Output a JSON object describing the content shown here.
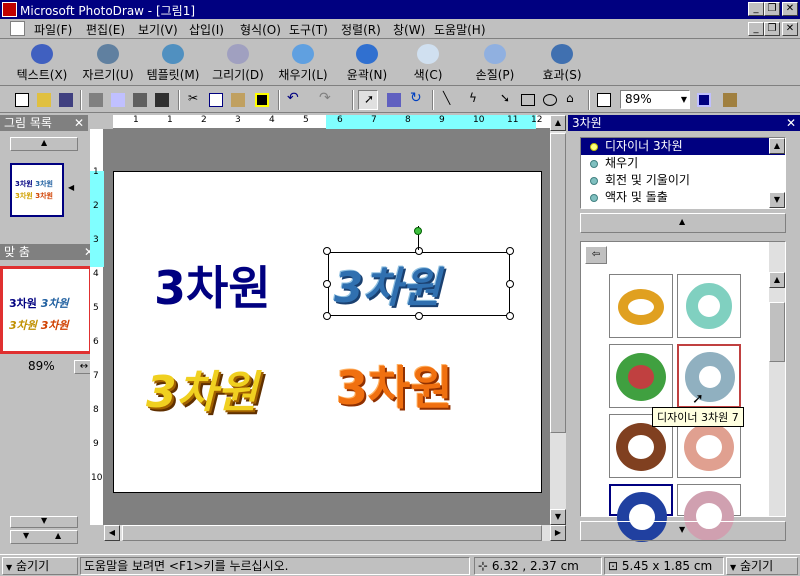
{
  "window": {
    "title": "Microsoft PhotoDraw - [그림1]"
  },
  "menu": [
    "파일(F)",
    "편집(E)",
    "보기(V)",
    "삽입(I)",
    "형식(O)",
    "도구(T)",
    "정렬(R)",
    "창(W)",
    "도움말(H)"
  ],
  "big_toolbar": [
    "텍스트(X)",
    "자르기(U)",
    "템플릿(M)",
    "그리기(D)",
    "채우기(L)",
    "윤곽(N)",
    "색(C)",
    "손질(P)",
    "효과(S)"
  ],
  "zoom": "89%",
  "left_panel": {
    "title": "그림 목록",
    "fit_title": "맞 춤",
    "fit_zoom": "89%"
  },
  "canvas": {
    "text1": "3차원",
    "text2": "3차원",
    "text3": "3차원",
    "text4": "3차원"
  },
  "thumbs": {
    "a": "3차원",
    "b": "3차원",
    "c": "3차원",
    "d": "3차원"
  },
  "right_panel": {
    "title": "3차원",
    "list": [
      "디자이너 3차원",
      "채우기",
      "회전 및 기울이기",
      "액자 및 돌출"
    ],
    "tooltip": "디자이너 3차원 7"
  },
  "hruler_nums": [
    "1",
    "1",
    "2",
    "3",
    "4",
    "5",
    "6",
    "7",
    "8",
    "9",
    "10",
    "11",
    "12",
    "1"
  ],
  "vruler_nums": [
    "1",
    "2",
    "3",
    "4",
    "5",
    "6",
    "7",
    "8",
    "9",
    "10"
  ],
  "status": {
    "hide_left": "숨기기",
    "help": "도움말을 보려면 <F1>키를 누르십시오.",
    "pos": "6.32 , 2.37 cm",
    "size": "5.45 x 1.85 cm",
    "hide_right": "숨기기"
  },
  "colors": {
    "navy": "#000080",
    "selected": "#000080",
    "ruler_highlight": "#80ffff"
  }
}
